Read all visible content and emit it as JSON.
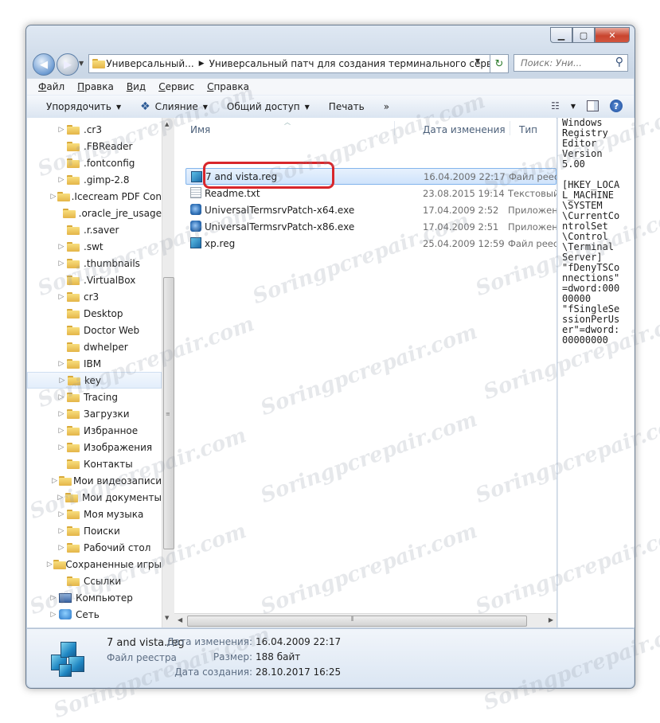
{
  "address": {
    "crumb1": "Универсальный...",
    "crumb2": "Универсальный патч для создания терминального сервера",
    "prefix": "«"
  },
  "search": {
    "placeholder": "Поиск: Уни..."
  },
  "menu": [
    {
      "label": "Файл",
      "ul": "Ф",
      "rest": "айл"
    },
    {
      "label": "Правка",
      "ul": "П",
      "rest": "равка"
    },
    {
      "label": "Вид",
      "ul": "В",
      "rest": "ид"
    },
    {
      "label": "Сервис",
      "ul": "С",
      "rest": "ервис"
    },
    {
      "label": "Справка",
      "ul": "С",
      "rest": "правка"
    }
  ],
  "toolbar": {
    "organize": "Упорядочить",
    "merge": "Слияние",
    "share": "Общий доступ",
    "print": "Печать",
    "more": "»"
  },
  "nav": [
    {
      "label": ".cr3",
      "tri": "▷",
      "icon": "folder"
    },
    {
      "label": ".FBReader",
      "tri": "",
      "icon": "folder"
    },
    {
      "label": ".fontconfig",
      "tri": "",
      "icon": "folder"
    },
    {
      "label": ".gimp-2.8",
      "tri": "▷",
      "icon": "folder"
    },
    {
      "label": ".Icecream PDF Con",
      "tri": "▷",
      "icon": "folder"
    },
    {
      "label": ".oracle_jre_usage",
      "tri": "",
      "icon": "folder"
    },
    {
      "label": ".r.saver",
      "tri": "",
      "icon": "folder"
    },
    {
      "label": ".swt",
      "tri": "▷",
      "icon": "folder"
    },
    {
      "label": ".thumbnails",
      "tri": "▷",
      "icon": "folder"
    },
    {
      "label": ".VirtualBox",
      "tri": "",
      "icon": "folder"
    },
    {
      "label": "cr3",
      "tri": "▷",
      "icon": "folder"
    },
    {
      "label": "Desktop",
      "tri": "",
      "icon": "folder"
    },
    {
      "label": "Doctor Web",
      "tri": "",
      "icon": "folder"
    },
    {
      "label": "dwhelper",
      "tri": "",
      "icon": "folder"
    },
    {
      "label": "IBM",
      "tri": "▷",
      "icon": "folder"
    },
    {
      "label": "key",
      "tri": "▷",
      "icon": "folder",
      "selected": true
    },
    {
      "label": "Tracing",
      "tri": "▷",
      "icon": "folder"
    },
    {
      "label": "Загрузки",
      "tri": "▷",
      "icon": "folder"
    },
    {
      "label": "Избранное",
      "tri": "▷",
      "icon": "folder"
    },
    {
      "label": "Изображения",
      "tri": "▷",
      "icon": "folder"
    },
    {
      "label": "Контакты",
      "tri": "",
      "icon": "folder"
    },
    {
      "label": "Мои видеозаписи",
      "tri": "▷",
      "icon": "folder"
    },
    {
      "label": "Мои документы",
      "tri": "▷",
      "icon": "folder"
    },
    {
      "label": "Моя музыка",
      "tri": "▷",
      "icon": "folder"
    },
    {
      "label": "Поиски",
      "tri": "▷",
      "icon": "folder"
    },
    {
      "label": "Рабочий стол",
      "tri": "▷",
      "icon": "folder"
    },
    {
      "label": "Сохраненные игры",
      "tri": "▷",
      "icon": "folder"
    },
    {
      "label": "Ссылки",
      "tri": "",
      "icon": "folder"
    },
    {
      "label": "Компьютер",
      "tri": "▷",
      "icon": "computer",
      "root": true
    },
    {
      "label": "Сеть",
      "tri": "▷",
      "icon": "network",
      "root": true
    }
  ],
  "columns": {
    "name": "Имя",
    "date": "Дата изменения",
    "type": "Тип"
  },
  "files": [
    {
      "name": "7 and vista.reg",
      "date": "16.04.2009 22:17",
      "type": "Файл реестра",
      "icon": "reg",
      "selected": true
    },
    {
      "name": "Readme.txt",
      "date": "23.08.2015 19:14",
      "type": "Текстовый док",
      "icon": "txt"
    },
    {
      "name": "UniversalTermsrvPatch-x64.exe",
      "date": "17.04.2009 2:52",
      "type": "Приложение",
      "icon": "exe"
    },
    {
      "name": "UniversalTermsrvPatch-x86.exe",
      "date": "17.04.2009 2:51",
      "type": "Приложение",
      "icon": "exe"
    },
    {
      "name": "xp.reg",
      "date": "25.04.2009 12:59",
      "type": "Файл реестра",
      "icon": "reg"
    }
  ],
  "preview_text": "Windows\nRegistry\nEditor\nVersion\n5.00\n\n[HKEY_LOCA\nL_MACHINE\n\\SYSTEM\n\\CurrentCo\nntrolSet\n\\Control\n\\Terminal\nServer]\n\"fDenyTSCo\nnnections\"\n=dword:000\n00000\n\"fSingleSe\nssionPerUs\ner\"=dword:\n00000000",
  "details": {
    "name": "7 and vista.reg",
    "type": "Файл реестра",
    "modified_label": "Дата изменения:",
    "modified": "16.04.2009 22:17",
    "size_label": "Размер:",
    "size": "188 байт",
    "created_label": "Дата создания:",
    "created": "28.10.2017 16:25"
  },
  "watermark": "Soringpcrepair.com",
  "colors": {
    "highlight": "#d8262b",
    "selection": "#cfe3fb"
  }
}
